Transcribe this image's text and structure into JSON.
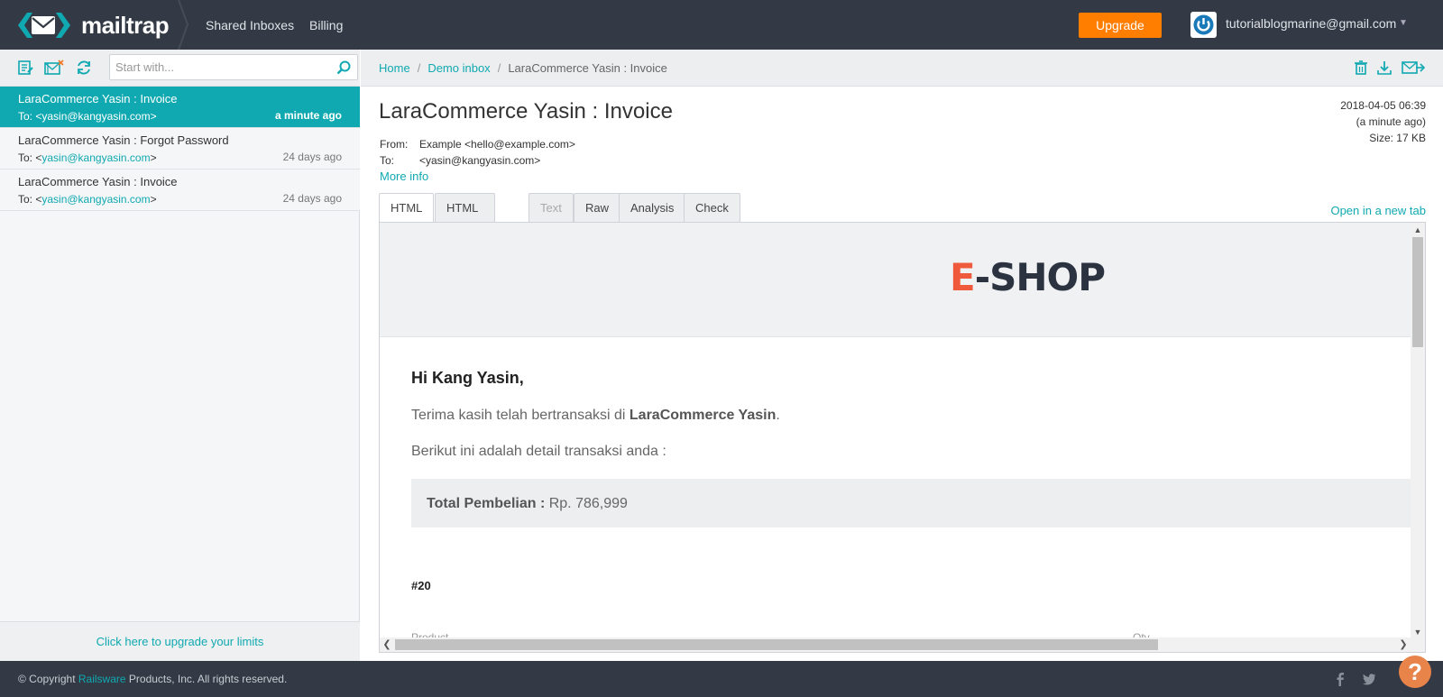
{
  "app": {
    "name": "mailtrap"
  },
  "nav": {
    "shared_inboxes": "Shared Inboxes",
    "billing": "Billing"
  },
  "header": {
    "upgrade_label": "Upgrade",
    "user_email": "tutorialblogmarine@gmail.com",
    "caret": "▼"
  },
  "icons": {
    "compose": "edit-list-icon",
    "clean": "clear-inbox-icon",
    "refresh": "refresh-icon",
    "search": "search-icon",
    "delete": "trash-icon",
    "download": "download-icon",
    "forward": "forward-mail-icon",
    "facebook": "facebook-icon",
    "twitter": "twitter-icon"
  },
  "search": {
    "placeholder": "Start with..."
  },
  "messages": [
    {
      "subject": "LaraCommerce Yasin : Invoice",
      "to_prefix": "To: <",
      "to_addr": "yasin@kangyasin.com",
      "to_suffix": ">",
      "time": "a minute ago",
      "active": true
    },
    {
      "subject": "LaraCommerce Yasin : Forgot Password",
      "to_prefix": "To: <",
      "to_addr": "yasin@kangyasin.com",
      "to_suffix": ">",
      "time": "24 days ago",
      "active": false
    },
    {
      "subject": "LaraCommerce Yasin : Invoice",
      "to_prefix": "To: <",
      "to_addr": "yasin@kangyasin.com",
      "to_suffix": ">",
      "time": "24 days ago",
      "active": false
    }
  ],
  "upgrade_limits": "Click here to upgrade your limits",
  "breadcrumb": {
    "home": "Home",
    "inbox": "Demo inbox",
    "current": "LaraCommerce Yasin : Invoice",
    "sep": "/"
  },
  "message": {
    "title": "LaraCommerce Yasin : Invoice",
    "from_label": "From:",
    "from_value": "Example <hello@example.com>",
    "to_label": "To:",
    "to_value": "<yasin@kangyasin.com>",
    "more_info": "More info",
    "date": "2018-04-05 06:39",
    "relative": "(a minute ago)",
    "size": "Size: 17 KB"
  },
  "tabs": [
    {
      "label": "HTML",
      "state": "active"
    },
    {
      "label": "HTML Source",
      "state": "normal"
    },
    {
      "label": "Text",
      "state": "disabled"
    },
    {
      "label": "Raw",
      "state": "normal"
    },
    {
      "label": "Analysis",
      "state": "normal"
    },
    {
      "label": "Check HTML",
      "state": "normal"
    }
  ],
  "open_new_tab": "Open in a new tab",
  "email": {
    "logo_e": "E",
    "logo_rest": "-SHOP",
    "greeting": "Hi Kang Yasin,",
    "thanks_pre": "Terima kasih telah bertransaksi di ",
    "thanks_bold": "LaraCommerce Yasin",
    "thanks_post": ".",
    "detail": "Berikut ini adalah detail transaksi anda :",
    "total_label": "Total Pembelian :",
    "total_value": " Rp. 786,999",
    "order_no": "#20",
    "col_product": "Product",
    "col_qty": "Qty"
  },
  "scroll": {
    "up": "▲",
    "down": "▼",
    "left": "❮",
    "right": "❯"
  },
  "footer": {
    "copy_pre": "© Copyright ",
    "copy_link": "Railsware",
    "copy_post": " Products, Inc. All rights reserved."
  },
  "help": "?",
  "colors": {
    "accent": "#10a9b1",
    "upgrade": "#ff7e00",
    "topbar": "#333a45",
    "eshop_e": "#f05a3c"
  }
}
